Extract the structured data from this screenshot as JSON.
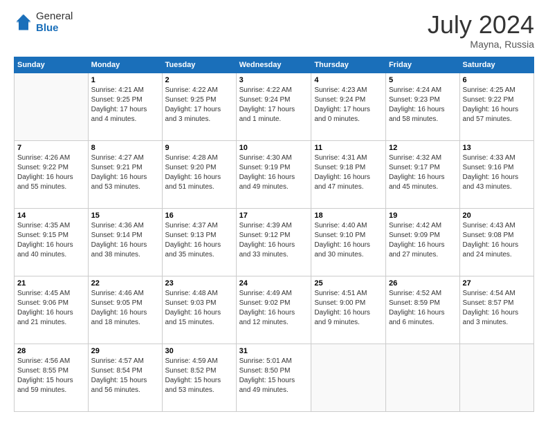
{
  "header": {
    "logo_general": "General",
    "logo_blue": "Blue",
    "title": "July 2024",
    "location": "Mayna, Russia"
  },
  "calendar": {
    "days_of_week": [
      "Sunday",
      "Monday",
      "Tuesday",
      "Wednesday",
      "Thursday",
      "Friday",
      "Saturday"
    ],
    "weeks": [
      [
        {
          "day": "",
          "info": ""
        },
        {
          "day": "1",
          "info": "Sunrise: 4:21 AM\nSunset: 9:25 PM\nDaylight: 17 hours\nand 4 minutes."
        },
        {
          "day": "2",
          "info": "Sunrise: 4:22 AM\nSunset: 9:25 PM\nDaylight: 17 hours\nand 3 minutes."
        },
        {
          "day": "3",
          "info": "Sunrise: 4:22 AM\nSunset: 9:24 PM\nDaylight: 17 hours\nand 1 minute."
        },
        {
          "day": "4",
          "info": "Sunrise: 4:23 AM\nSunset: 9:24 PM\nDaylight: 17 hours\nand 0 minutes."
        },
        {
          "day": "5",
          "info": "Sunrise: 4:24 AM\nSunset: 9:23 PM\nDaylight: 16 hours\nand 58 minutes."
        },
        {
          "day": "6",
          "info": "Sunrise: 4:25 AM\nSunset: 9:22 PM\nDaylight: 16 hours\nand 57 minutes."
        }
      ],
      [
        {
          "day": "7",
          "info": "Sunrise: 4:26 AM\nSunset: 9:22 PM\nDaylight: 16 hours\nand 55 minutes."
        },
        {
          "day": "8",
          "info": "Sunrise: 4:27 AM\nSunset: 9:21 PM\nDaylight: 16 hours\nand 53 minutes."
        },
        {
          "day": "9",
          "info": "Sunrise: 4:28 AM\nSunset: 9:20 PM\nDaylight: 16 hours\nand 51 minutes."
        },
        {
          "day": "10",
          "info": "Sunrise: 4:30 AM\nSunset: 9:19 PM\nDaylight: 16 hours\nand 49 minutes."
        },
        {
          "day": "11",
          "info": "Sunrise: 4:31 AM\nSunset: 9:18 PM\nDaylight: 16 hours\nand 47 minutes."
        },
        {
          "day": "12",
          "info": "Sunrise: 4:32 AM\nSunset: 9:17 PM\nDaylight: 16 hours\nand 45 minutes."
        },
        {
          "day": "13",
          "info": "Sunrise: 4:33 AM\nSunset: 9:16 PM\nDaylight: 16 hours\nand 43 minutes."
        }
      ],
      [
        {
          "day": "14",
          "info": "Sunrise: 4:35 AM\nSunset: 9:15 PM\nDaylight: 16 hours\nand 40 minutes."
        },
        {
          "day": "15",
          "info": "Sunrise: 4:36 AM\nSunset: 9:14 PM\nDaylight: 16 hours\nand 38 minutes."
        },
        {
          "day": "16",
          "info": "Sunrise: 4:37 AM\nSunset: 9:13 PM\nDaylight: 16 hours\nand 35 minutes."
        },
        {
          "day": "17",
          "info": "Sunrise: 4:39 AM\nSunset: 9:12 PM\nDaylight: 16 hours\nand 33 minutes."
        },
        {
          "day": "18",
          "info": "Sunrise: 4:40 AM\nSunset: 9:10 PM\nDaylight: 16 hours\nand 30 minutes."
        },
        {
          "day": "19",
          "info": "Sunrise: 4:42 AM\nSunset: 9:09 PM\nDaylight: 16 hours\nand 27 minutes."
        },
        {
          "day": "20",
          "info": "Sunrise: 4:43 AM\nSunset: 9:08 PM\nDaylight: 16 hours\nand 24 minutes."
        }
      ],
      [
        {
          "day": "21",
          "info": "Sunrise: 4:45 AM\nSunset: 9:06 PM\nDaylight: 16 hours\nand 21 minutes."
        },
        {
          "day": "22",
          "info": "Sunrise: 4:46 AM\nSunset: 9:05 PM\nDaylight: 16 hours\nand 18 minutes."
        },
        {
          "day": "23",
          "info": "Sunrise: 4:48 AM\nSunset: 9:03 PM\nDaylight: 16 hours\nand 15 minutes."
        },
        {
          "day": "24",
          "info": "Sunrise: 4:49 AM\nSunset: 9:02 PM\nDaylight: 16 hours\nand 12 minutes."
        },
        {
          "day": "25",
          "info": "Sunrise: 4:51 AM\nSunset: 9:00 PM\nDaylight: 16 hours\nand 9 minutes."
        },
        {
          "day": "26",
          "info": "Sunrise: 4:52 AM\nSunset: 8:59 PM\nDaylight: 16 hours\nand 6 minutes."
        },
        {
          "day": "27",
          "info": "Sunrise: 4:54 AM\nSunset: 8:57 PM\nDaylight: 16 hours\nand 3 minutes."
        }
      ],
      [
        {
          "day": "28",
          "info": "Sunrise: 4:56 AM\nSunset: 8:55 PM\nDaylight: 15 hours\nand 59 minutes."
        },
        {
          "day": "29",
          "info": "Sunrise: 4:57 AM\nSunset: 8:54 PM\nDaylight: 15 hours\nand 56 minutes."
        },
        {
          "day": "30",
          "info": "Sunrise: 4:59 AM\nSunset: 8:52 PM\nDaylight: 15 hours\nand 53 minutes."
        },
        {
          "day": "31",
          "info": "Sunrise: 5:01 AM\nSunset: 8:50 PM\nDaylight: 15 hours\nand 49 minutes."
        },
        {
          "day": "",
          "info": ""
        },
        {
          "day": "",
          "info": ""
        },
        {
          "day": "",
          "info": ""
        }
      ]
    ]
  }
}
